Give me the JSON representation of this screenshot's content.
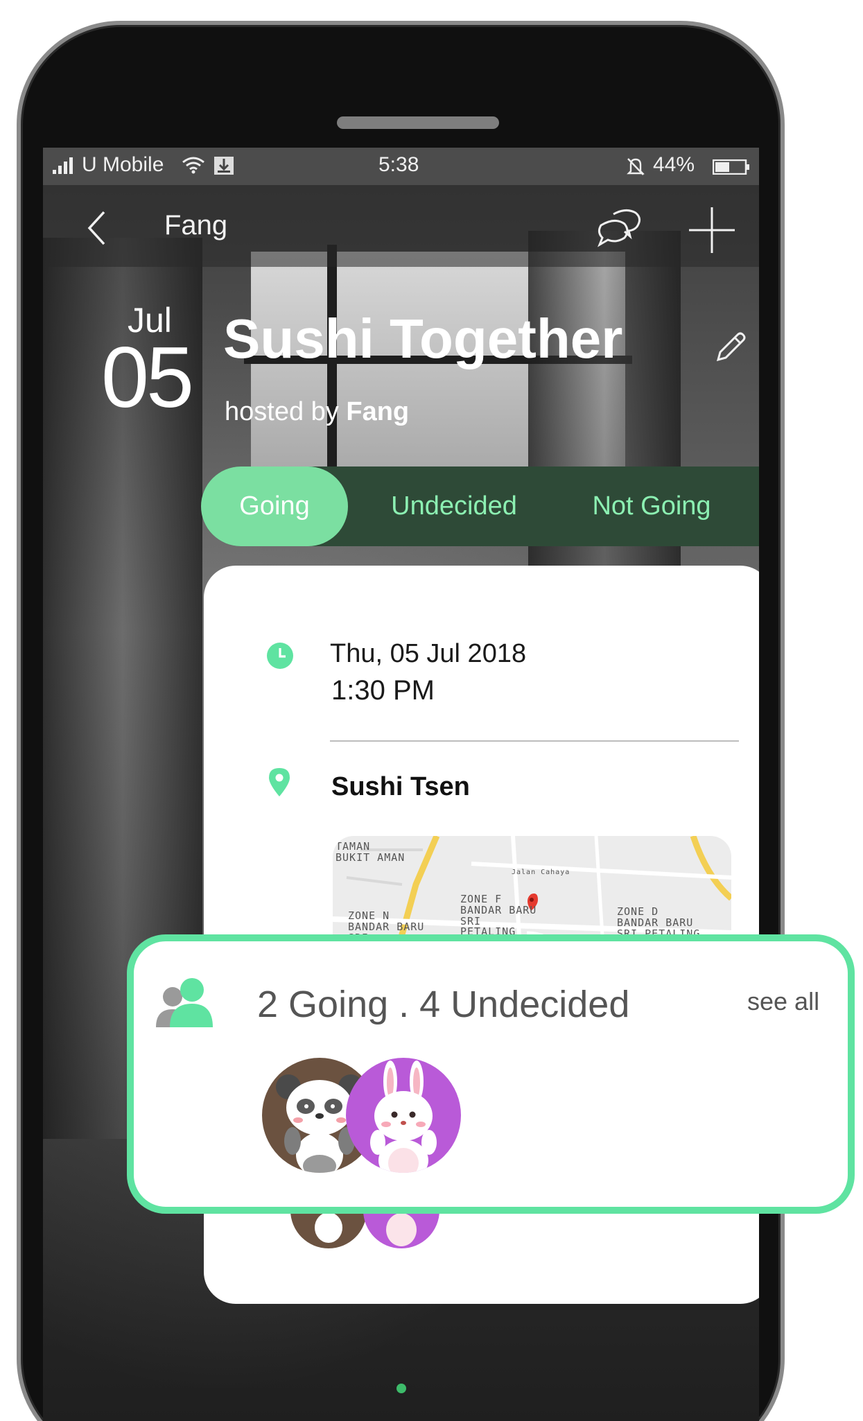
{
  "status_bar": {
    "carrier": "U Mobile",
    "time": "5:38",
    "battery": "44%"
  },
  "nav": {
    "title": "Fang",
    "icons": [
      "back-icon",
      "chat-icon",
      "plus-icon"
    ]
  },
  "event": {
    "month": "Jul",
    "day": "05",
    "title": "Sushi Together",
    "hosted_prefix": "hosted by",
    "host": "Fang"
  },
  "tabs": [
    {
      "label": "Going",
      "active": true
    },
    {
      "label": "Undecided",
      "active": false
    },
    {
      "label": "Not Going",
      "active": false
    }
  ],
  "details": {
    "date": "Thu, 05 Jul 2018",
    "time": "1:30 PM",
    "venue": "Sushi Tsen"
  },
  "map": {
    "labels": [
      "TAMAN BUKIT AMAN",
      "ZONE F BANDAR BARU SRI PETALING",
      "ZONE N BANDAR BARU SRI PETALING",
      "ZONE D BANDAR BARU SRI PETALING",
      "Jalan Cahaya"
    ]
  },
  "attendees": {
    "summary": "2 Going . 4 Undecided",
    "see_all": "see all",
    "avatars": [
      "panda-avatar",
      "bunny-avatar"
    ]
  },
  "colors": {
    "accent": "#5fe3a1",
    "tab_active": "#7bdfa1",
    "tab_bar": "#2e4a37",
    "tab_text": "#8cf0b2",
    "panda_bg": "#6b5240",
    "bunny_bg": "#b95ad8"
  }
}
